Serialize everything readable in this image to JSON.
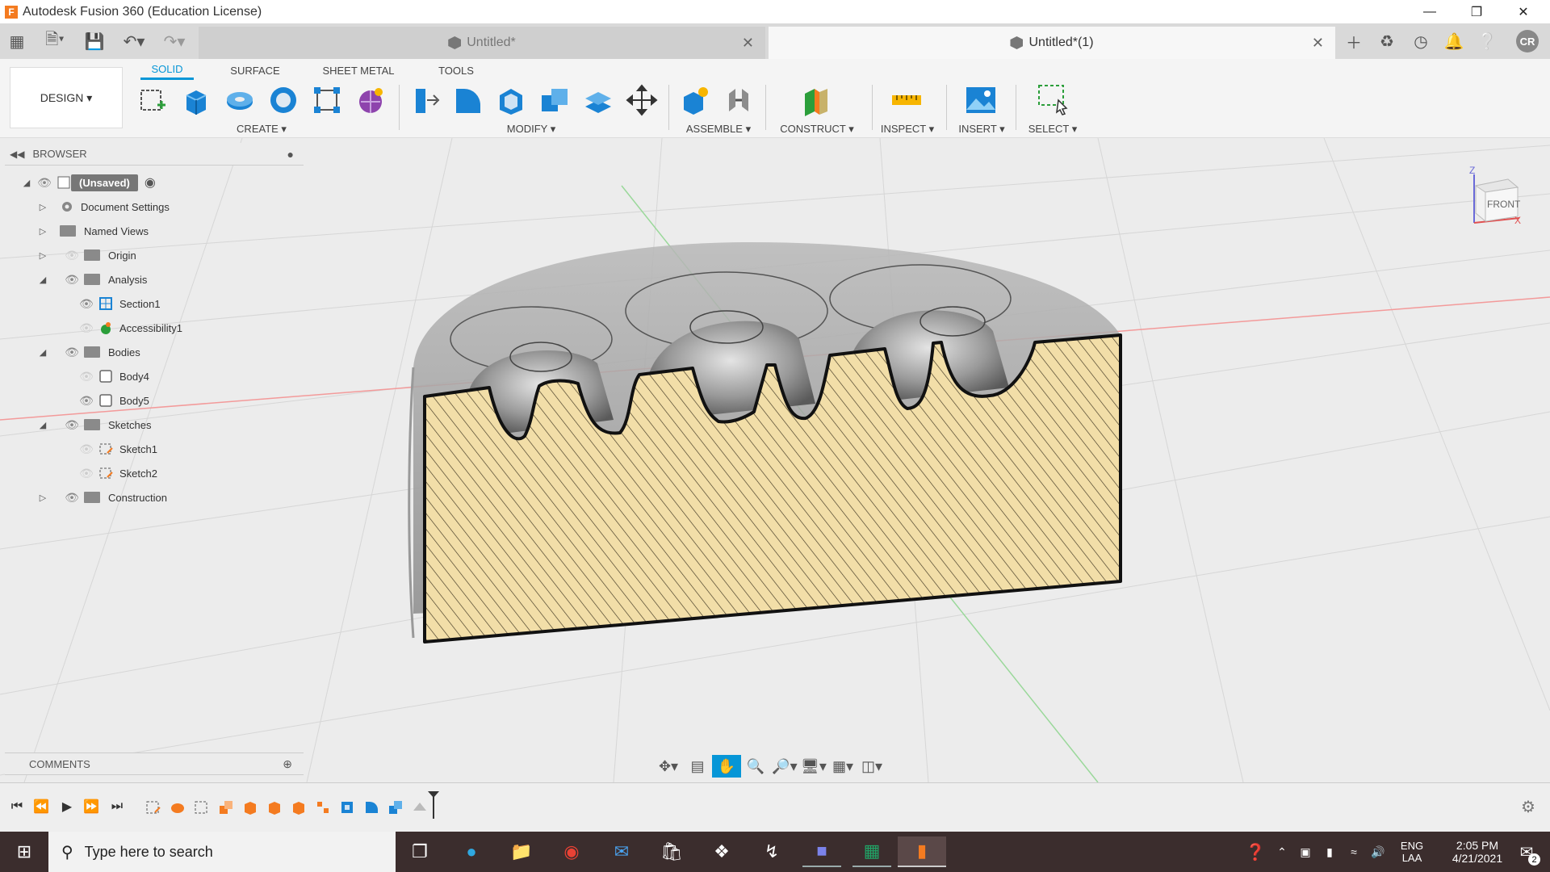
{
  "window": {
    "title": "Autodesk Fusion 360 (Education License)",
    "logo_letter": "F"
  },
  "tabs": [
    {
      "label": "Untitled*",
      "active": false
    },
    {
      "label": "Untitled*(1)",
      "active": true
    }
  ],
  "user_initials": "CR",
  "toolbar": {
    "workspace": "DESIGN ▾",
    "mode_tabs": [
      "SOLID",
      "SURFACE",
      "SHEET METAL",
      "TOOLS"
    ],
    "groups": [
      "CREATE ▾",
      "MODIFY ▾",
      "ASSEMBLE ▾",
      "CONSTRUCT ▾",
      "INSPECT ▾",
      "INSERT ▾",
      "SELECT ▾"
    ]
  },
  "browser": {
    "title": "BROWSER",
    "root": "(Unsaved)",
    "items": [
      {
        "label": "Document Settings"
      },
      {
        "label": "Named Views"
      },
      {
        "label": "Origin"
      },
      {
        "label": "Analysis"
      },
      {
        "label": "Section1"
      },
      {
        "label": "Accessibility1"
      },
      {
        "label": "Bodies"
      },
      {
        "label": "Body4"
      },
      {
        "label": "Body5"
      },
      {
        "label": "Sketches"
      },
      {
        "label": "Sketch1"
      },
      {
        "label": "Sketch2"
      },
      {
        "label": "Construction"
      }
    ]
  },
  "comments": {
    "title": "COMMENTS"
  },
  "viewcube": {
    "face": "FRONT",
    "axis_z": "Z",
    "axis_x": "X"
  },
  "colors": {
    "accent": "#0696d7",
    "section_fill": "#f2dea8",
    "body_gray": "#9b9b9b"
  },
  "taskbar": {
    "search_placeholder": "Type here to search",
    "language_top": "ENG",
    "language_bottom": "LAA",
    "time": "2:05 PM",
    "date": "4/21/2021",
    "notification_count": "2"
  }
}
